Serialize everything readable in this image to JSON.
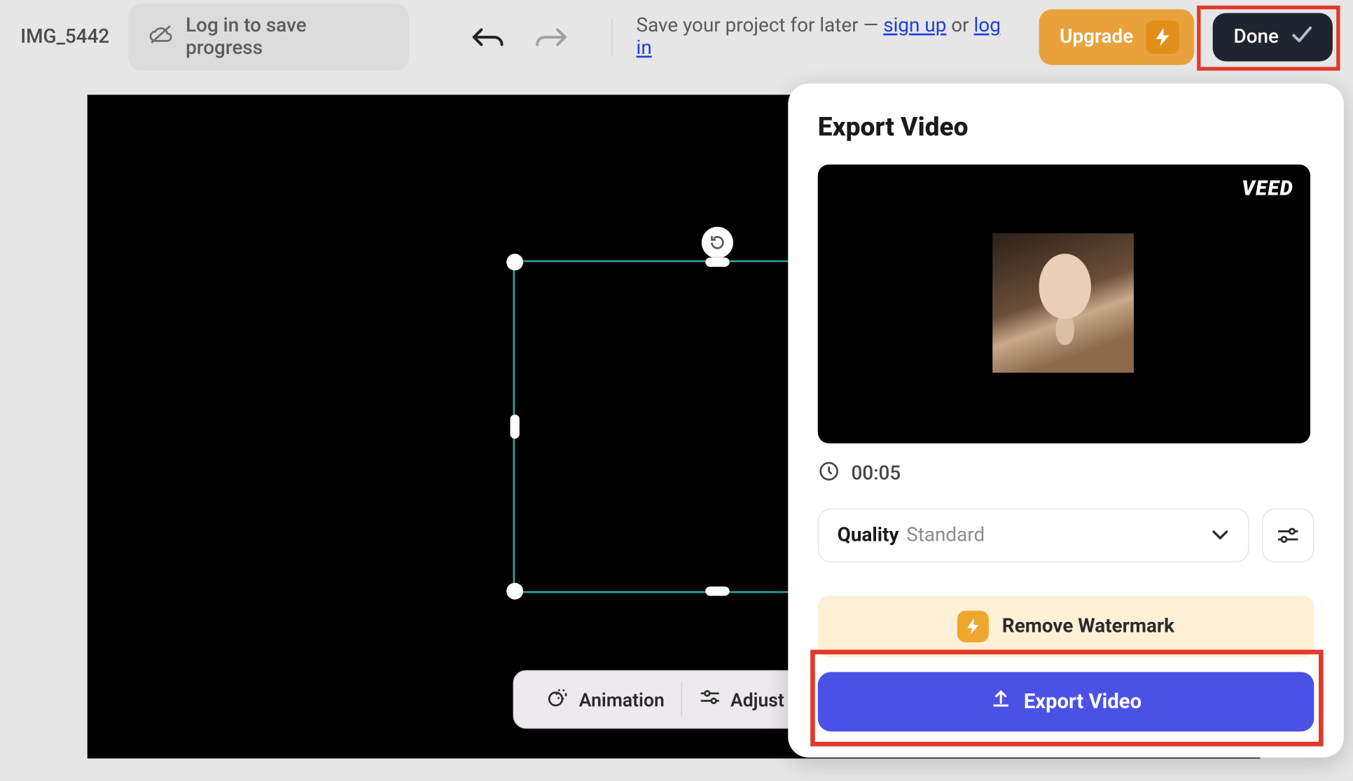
{
  "topbar": {
    "project_name": "IMG_5442",
    "login_prompt": "Log in to save progress",
    "save_text_prefix": "Save your project for later — ",
    "signup_label": "sign up",
    "or_label": " or ",
    "login_label": "log in",
    "upgrade_label": "Upgrade",
    "done_label": "Done"
  },
  "canvas": {
    "toolbar": {
      "animation_label": "Animation",
      "adjust_label": "Adjust"
    }
  },
  "export": {
    "title": "Export Video",
    "watermark_logo": "VEED",
    "duration": "00:05",
    "quality_label": "Quality",
    "quality_value": "Standard",
    "remove_watermark_label": "Remove Watermark",
    "export_button_label": "Export Video"
  }
}
